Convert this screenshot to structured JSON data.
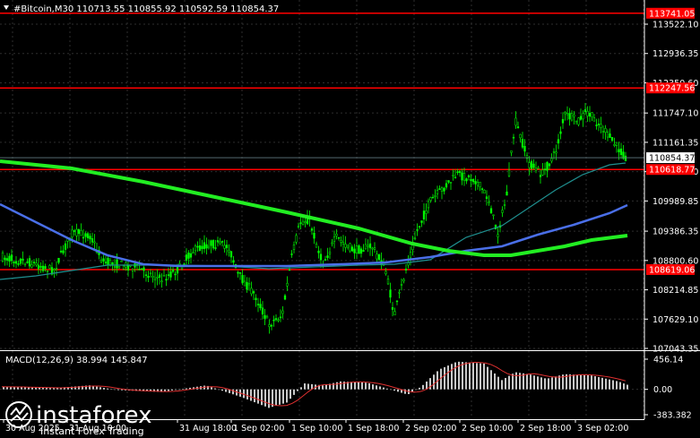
{
  "header": {
    "title": "#Bitcoin,M30  110713.55 110855.92 110592.59 110854.37"
  },
  "price_axis": {
    "ticks": [
      "113522.10",
      "112936.35",
      "112350.60",
      "111747.10",
      "111161.35",
      "110575.60",
      "109989.85",
      "109386.35",
      "108800.60",
      "108214.85",
      "107629.10",
      "107043.35"
    ],
    "tick_values": [
      113522.1,
      112936.35,
      112350.6,
      111747.1,
      111161.35,
      110575.6,
      109989.85,
      109386.35,
      108800.6,
      108214.85,
      107629.1,
      107043.35
    ],
    "current_price": "110854.37",
    "current_price_value": 110854.37
  },
  "levels": [
    {
      "label": "113741.05",
      "value": 113741.05,
      "color": "#ff0000"
    },
    {
      "label": "112247.56",
      "value": 112247.56,
      "color": "#ff0000"
    },
    {
      "label": "110618.77",
      "value": 110618.77,
      "color": "#ff0000"
    },
    {
      "label": "108619.06",
      "value": 108619.06,
      "color": "#ff0000"
    }
  ],
  "time_axis": {
    "labels": [
      "30 Aug 2025",
      "31 Aug 10:00",
      "31 Aug 18:00",
      "1 Sep 02:00",
      "1 Sep 10:00",
      "1 Sep 18:00",
      "2 Sep 02:00",
      "2 Sep 10:00",
      "2 Sep 18:00",
      "3 Sep 02:00"
    ]
  },
  "macd": {
    "title": "MACD(12,26,9) 38.994 145.847",
    "ticks": [
      "456.14",
      "0.00",
      "-383.382"
    ],
    "tick_values": [
      456.14,
      0,
      -383.382
    ]
  },
  "colors": {
    "background": "#000000",
    "grid": "#2a2a2a",
    "candle": "#00ff00",
    "ma_slow": "#22ee22",
    "ma_mid": "#4a6fe8",
    "ma_fast": "#1f8f8f",
    "macd_hist": "#c8c8c8",
    "macd_signal": "#e03030",
    "level": "#ff0000"
  },
  "logo": {
    "name": "instaforex",
    "tagline": "Instant Forex Trading"
  }
}
